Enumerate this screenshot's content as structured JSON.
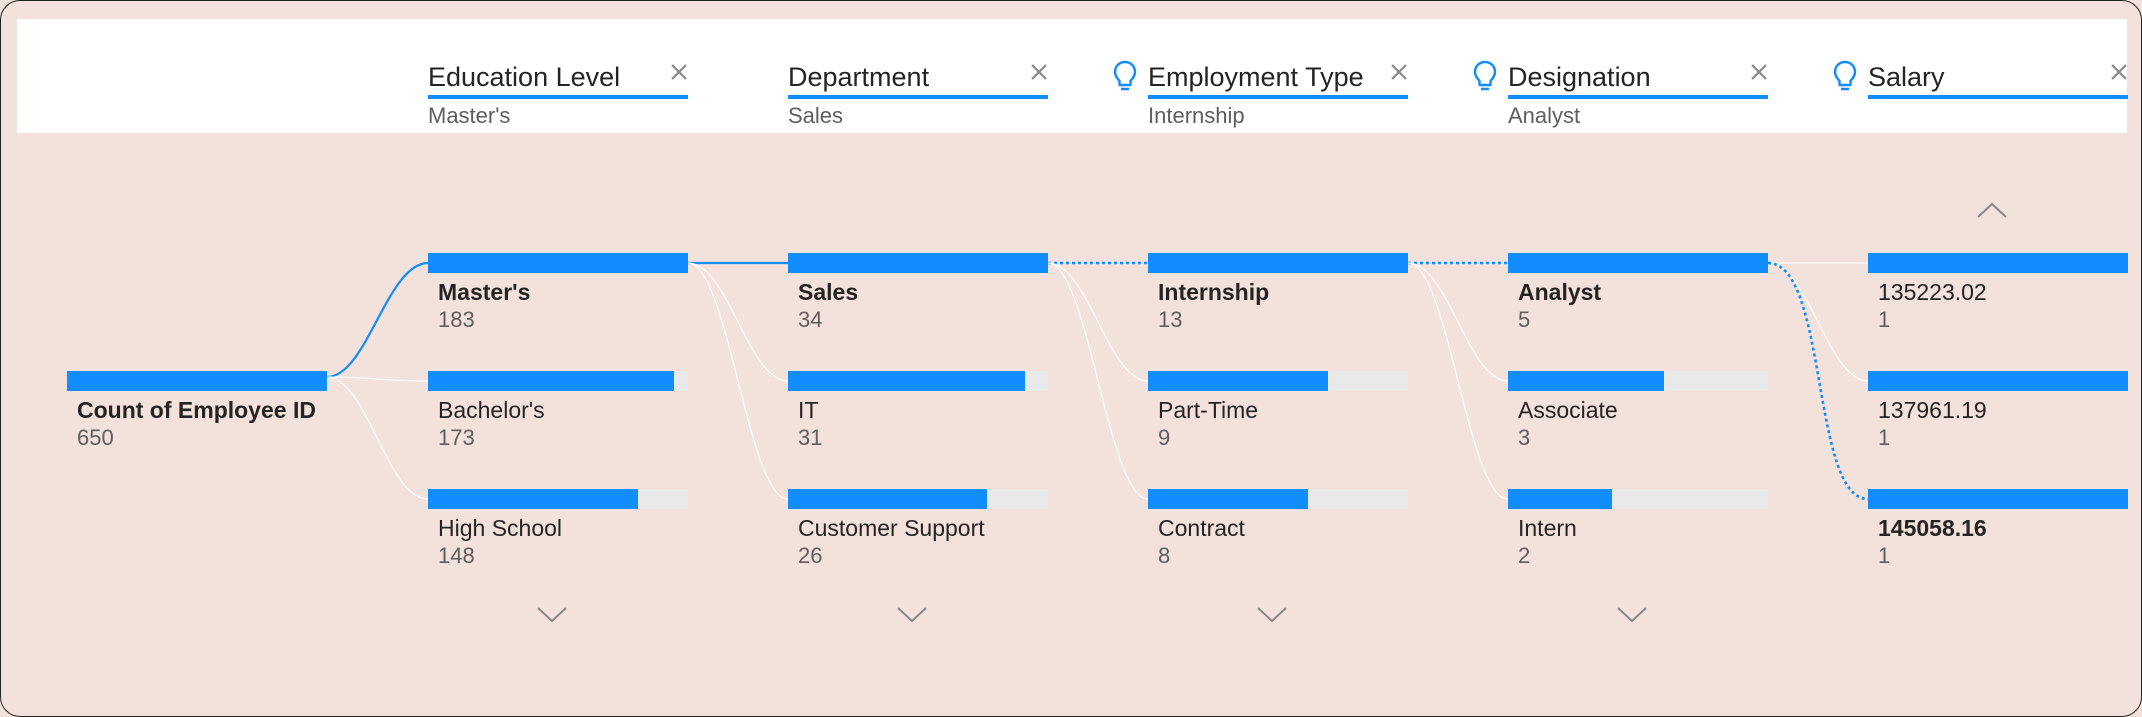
{
  "header": {
    "columns": [
      {
        "title": "Education Level",
        "selected": "Master's"
      },
      {
        "title": "Department",
        "selected": "Sales"
      },
      {
        "title": "Employment Type",
        "selected": "Internship"
      },
      {
        "title": "Designation",
        "selected": "Analyst"
      },
      {
        "title": "Salary",
        "selected": ""
      }
    ]
  },
  "root": {
    "label": "Count of Employee ID",
    "value": "650"
  },
  "levels": [
    {
      "nodes": [
        {
          "label": "Master's",
          "value": "183",
          "fraction": 1.0
        },
        {
          "label": "Bachelor's",
          "value": "173",
          "fraction": 0.945
        },
        {
          "label": "High School",
          "value": "148",
          "fraction": 0.809
        }
      ]
    },
    {
      "nodes": [
        {
          "label": "Sales",
          "value": "34",
          "fraction": 1.0
        },
        {
          "label": "IT",
          "value": "31",
          "fraction": 0.912
        },
        {
          "label": "Customer Support",
          "value": "26",
          "fraction": 0.765
        }
      ]
    },
    {
      "nodes": [
        {
          "label": "Internship",
          "value": "13",
          "fraction": 1.0
        },
        {
          "label": "Part-Time",
          "value": "9",
          "fraction": 0.692
        },
        {
          "label": "Contract",
          "value": "8",
          "fraction": 0.615
        }
      ]
    },
    {
      "nodes": [
        {
          "label": "Analyst",
          "value": "5",
          "fraction": 1.0
        },
        {
          "label": "Associate",
          "value": "3",
          "fraction": 0.6
        },
        {
          "label": "Intern",
          "value": "2",
          "fraction": 0.4
        }
      ]
    },
    {
      "nodes": [
        {
          "label": "135223.02",
          "value": "1",
          "fraction": 1.0
        },
        {
          "label": "137961.19",
          "value": "1",
          "fraction": 1.0
        },
        {
          "label": "145058.16",
          "value": "1",
          "fraction": 1.0
        }
      ]
    }
  ],
  "colors": {
    "accent": "#118dff",
    "background": "#f3e1db",
    "bar_track": "#e9e9e9"
  }
}
